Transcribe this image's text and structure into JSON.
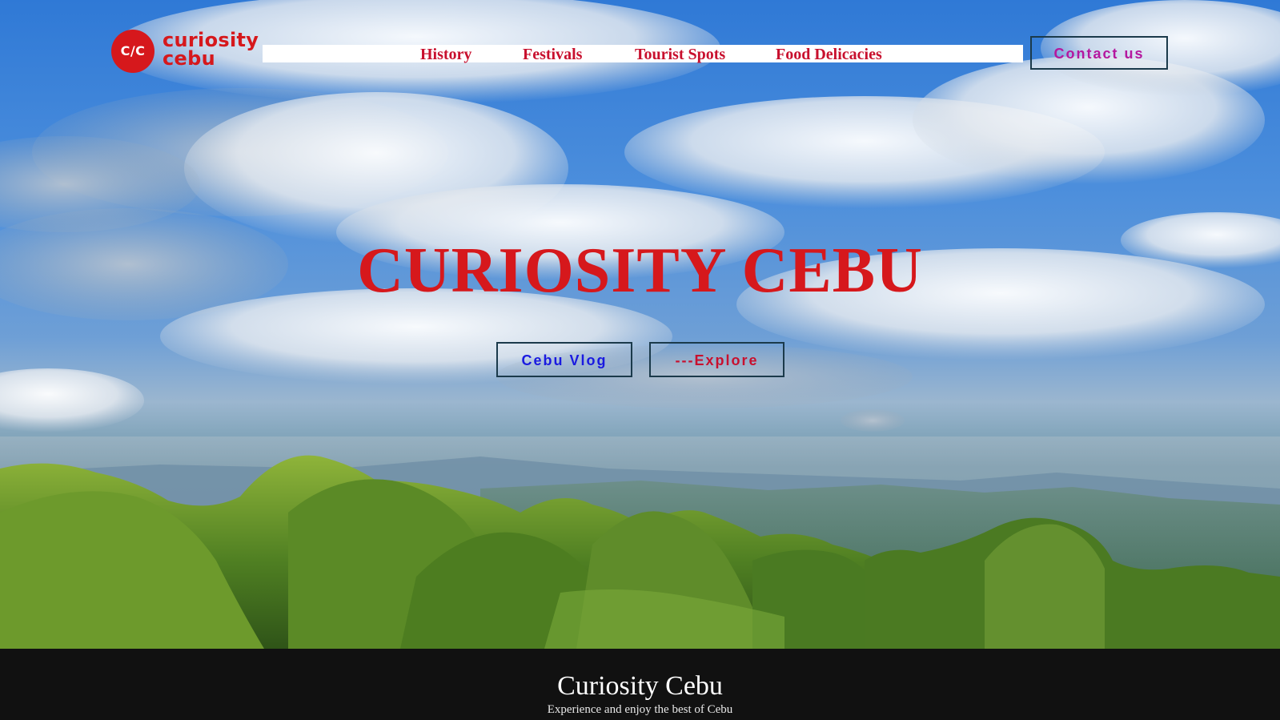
{
  "brand": {
    "badge_text": "C/C",
    "name_line1": "curiosity",
    "name_line2": "cebu",
    "color": "#d6181c"
  },
  "nav": {
    "items": [
      {
        "label": "History"
      },
      {
        "label": "Festivals"
      },
      {
        "label": "Tourist Spots"
      },
      {
        "label": "Food Delicacies"
      }
    ],
    "color": "#c8102e"
  },
  "header": {
    "contact_label": "Contact us",
    "contact_color": "#b5179e"
  },
  "hero": {
    "title": "CURIOSITY CEBU",
    "title_color": "#d6181c",
    "background": "sky with clouds over green rolling hills (Osmeña Peak landscape)",
    "buttons": {
      "vlog_label": "Cebu Vlog",
      "explore_label": "---Explore"
    }
  },
  "footer": {
    "title": "Curiosity Cebu",
    "tagline": "Experience and enjoy the best of Cebu",
    "background": "#111111"
  }
}
